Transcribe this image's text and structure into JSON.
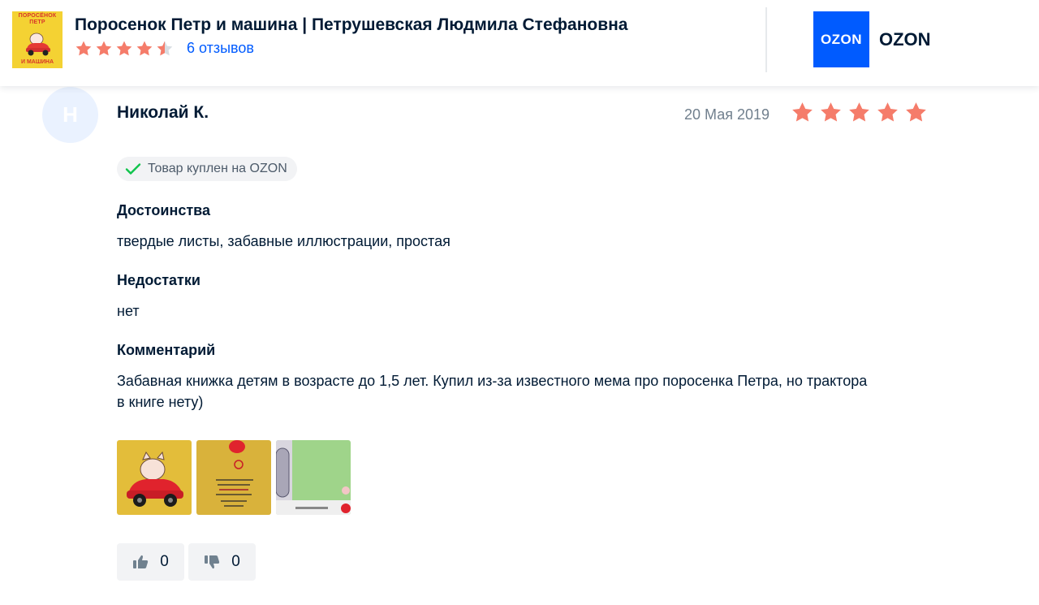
{
  "header": {
    "cover": {
      "title_line1": "ПОРОСЁНОК ПЕТР",
      "title_line2": "И МАШИНА"
    },
    "product_title": "Поросенок Петр и машина | Петрушевская Людмила Стефановна",
    "rating": 4.5,
    "reviews_link": "6 отзывов",
    "store_logo": "OZON",
    "store_name": "OZON"
  },
  "review": {
    "avatar_letter": "Н",
    "author": "Николай К.",
    "date": "20 Мая 2019",
    "rating": 5,
    "badge": "Товар куплен на OZON",
    "pros_title": "Достоинства",
    "pros_text": "твердые листы, забавные иллюстрации, простая",
    "cons_title": "Недостатки",
    "cons_text": "нет",
    "comment_title": "Комментарий",
    "comment_text": "Забавная книжка детям в возрасте до 1,5 лет. Купил из-за известного мема про поросенка Петра, но трактора в книге нету)",
    "likes": "0",
    "dislikes": "0"
  },
  "colors": {
    "star": "#f57c6a",
    "star_empty": "#d8dde2",
    "brand": "#005bff",
    "check": "#10c44c"
  },
  "icons": [
    "star-icon",
    "check-icon",
    "thumbs-up-icon",
    "thumbs-down-icon"
  ]
}
